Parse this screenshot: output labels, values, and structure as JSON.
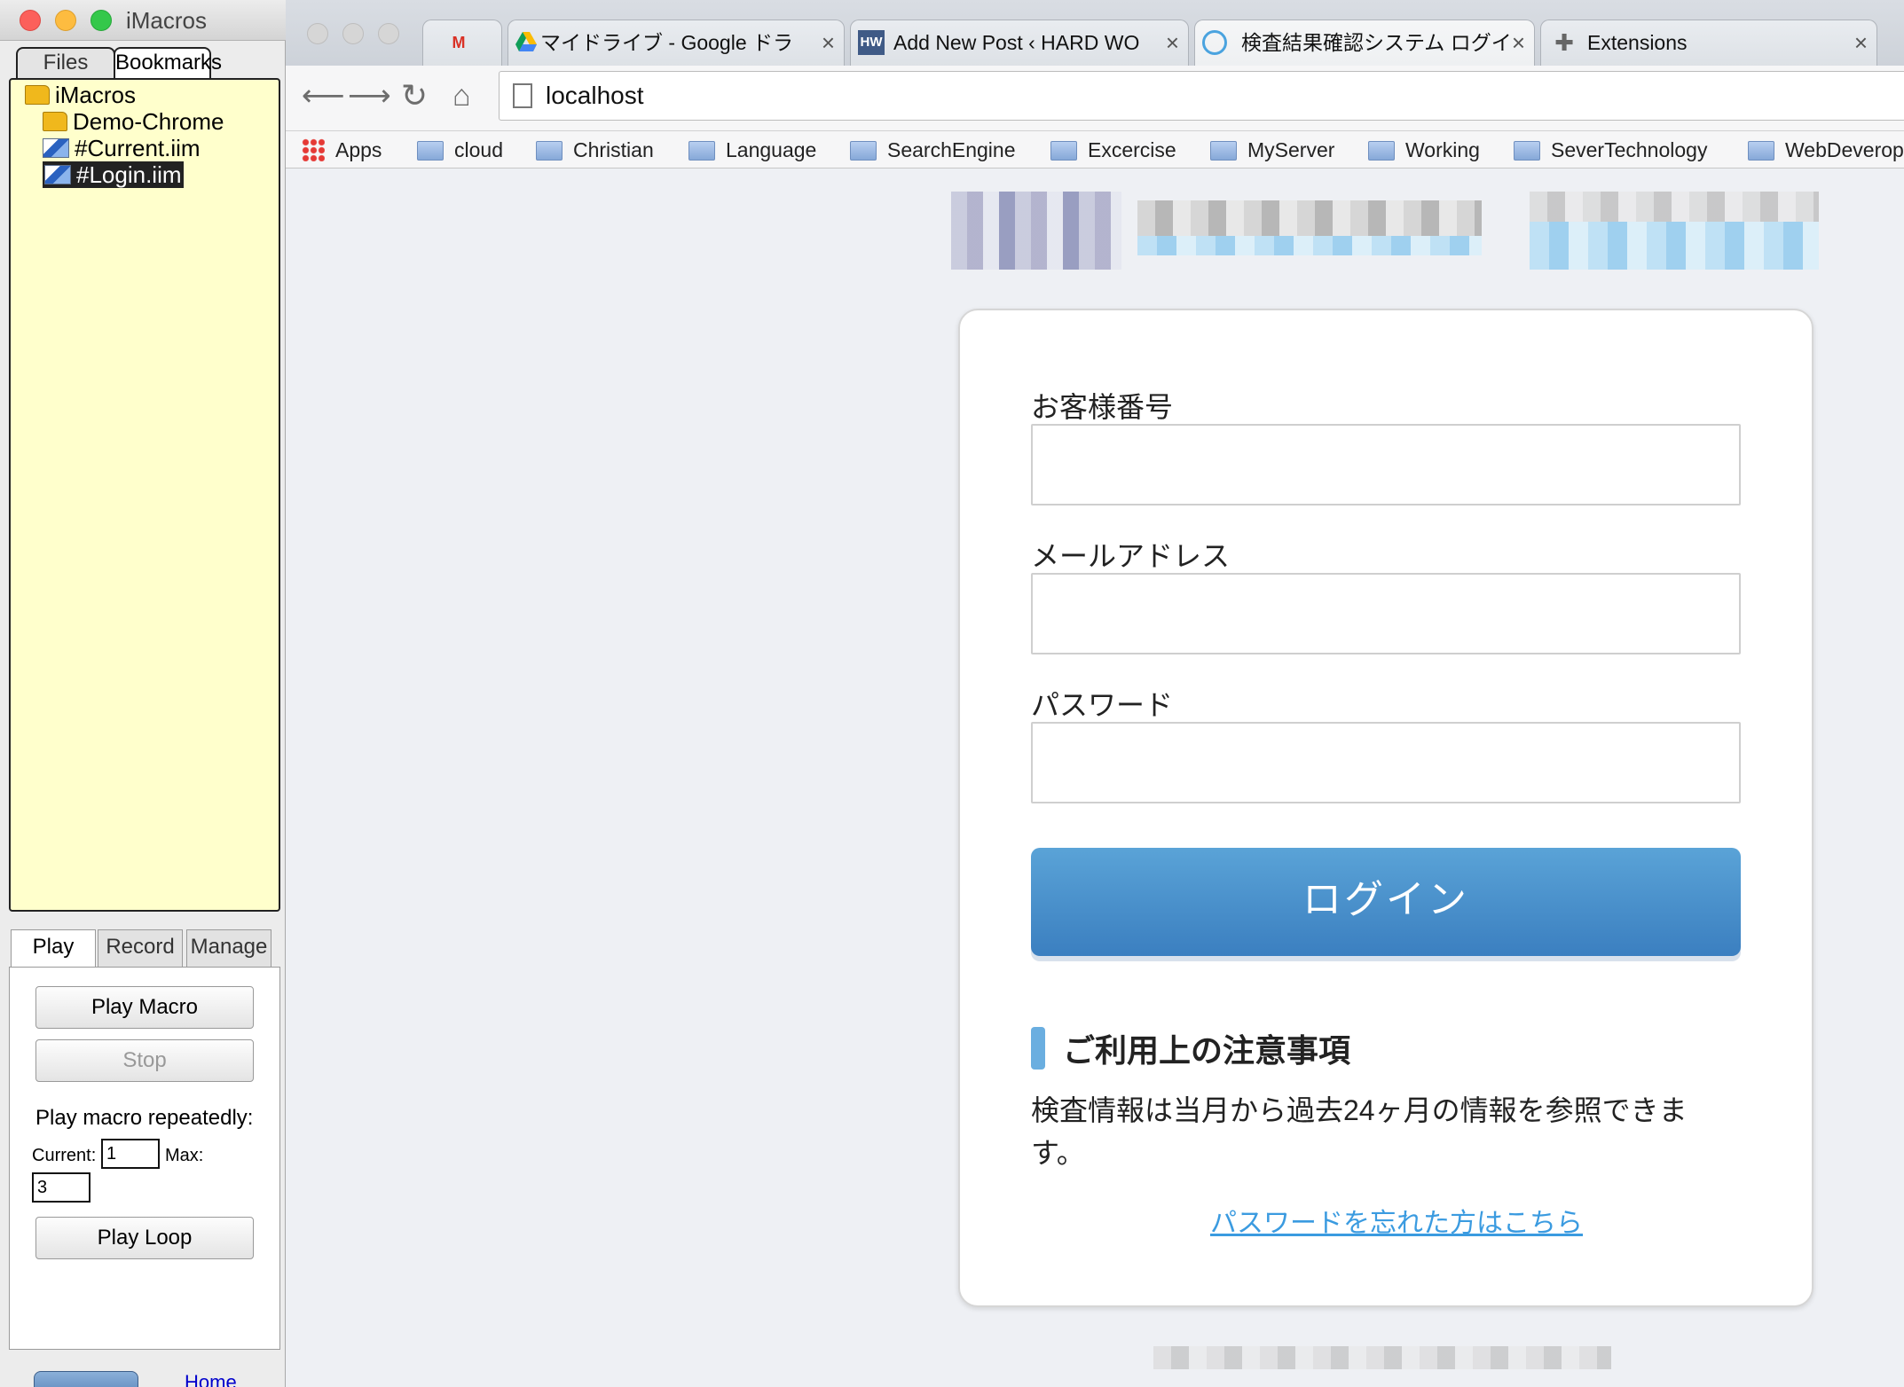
{
  "imacros": {
    "title": "iMacros",
    "top_tabs": [
      "Files",
      "Bookmarks"
    ],
    "tree": {
      "root": "iMacros",
      "folder": "Demo-Chrome",
      "files": [
        "#Current.iim",
        "#Login.iim"
      ]
    },
    "play_tabs": [
      "Play",
      "Record",
      "Manage"
    ],
    "play_macro": "Play Macro",
    "stop": "Stop",
    "repeat_label": "Play macro repeatedly:",
    "current_label": "Current:",
    "current_value": "1",
    "max_label": "Max:",
    "max_value": "3",
    "play_loop": "Play Loop",
    "home_link": "Home"
  },
  "browser": {
    "tabs": [
      {
        "icon": "gmail-icon",
        "title": ""
      },
      {
        "icon": "drive-icon",
        "title": "マイドライブ - Google ドラ"
      },
      {
        "icon": "hw-icon",
        "title": "Add New Post ‹ HARD WO"
      },
      {
        "icon": "loading-icon",
        "title": "検査結果確認システム ログイ"
      },
      {
        "icon": "puzzle-icon",
        "title": "Extensions"
      }
    ],
    "tab_close": "×",
    "url": "localhost",
    "bookmarks": [
      "Apps",
      "cloud",
      "Christian",
      "Language",
      "SearchEngine",
      "Excercise",
      "MyServer",
      "Working",
      "SeverTechnology",
      "WebDeverop"
    ]
  },
  "login": {
    "customer_label": "お客様番号",
    "email_label": "メールアドレス",
    "password_label": "パスワード",
    "login_button": "ログイン",
    "notice_heading": "ご利用上の注意事項",
    "notice_text": "検査情報は当月から過去24ヶ月の情報を参照できます。",
    "forgot_link": "パスワードを忘れた方はこちら"
  },
  "colors": {
    "tree_bg": "#ffffcc",
    "login_button": "#4a90d0",
    "link": "#3b9be0"
  }
}
